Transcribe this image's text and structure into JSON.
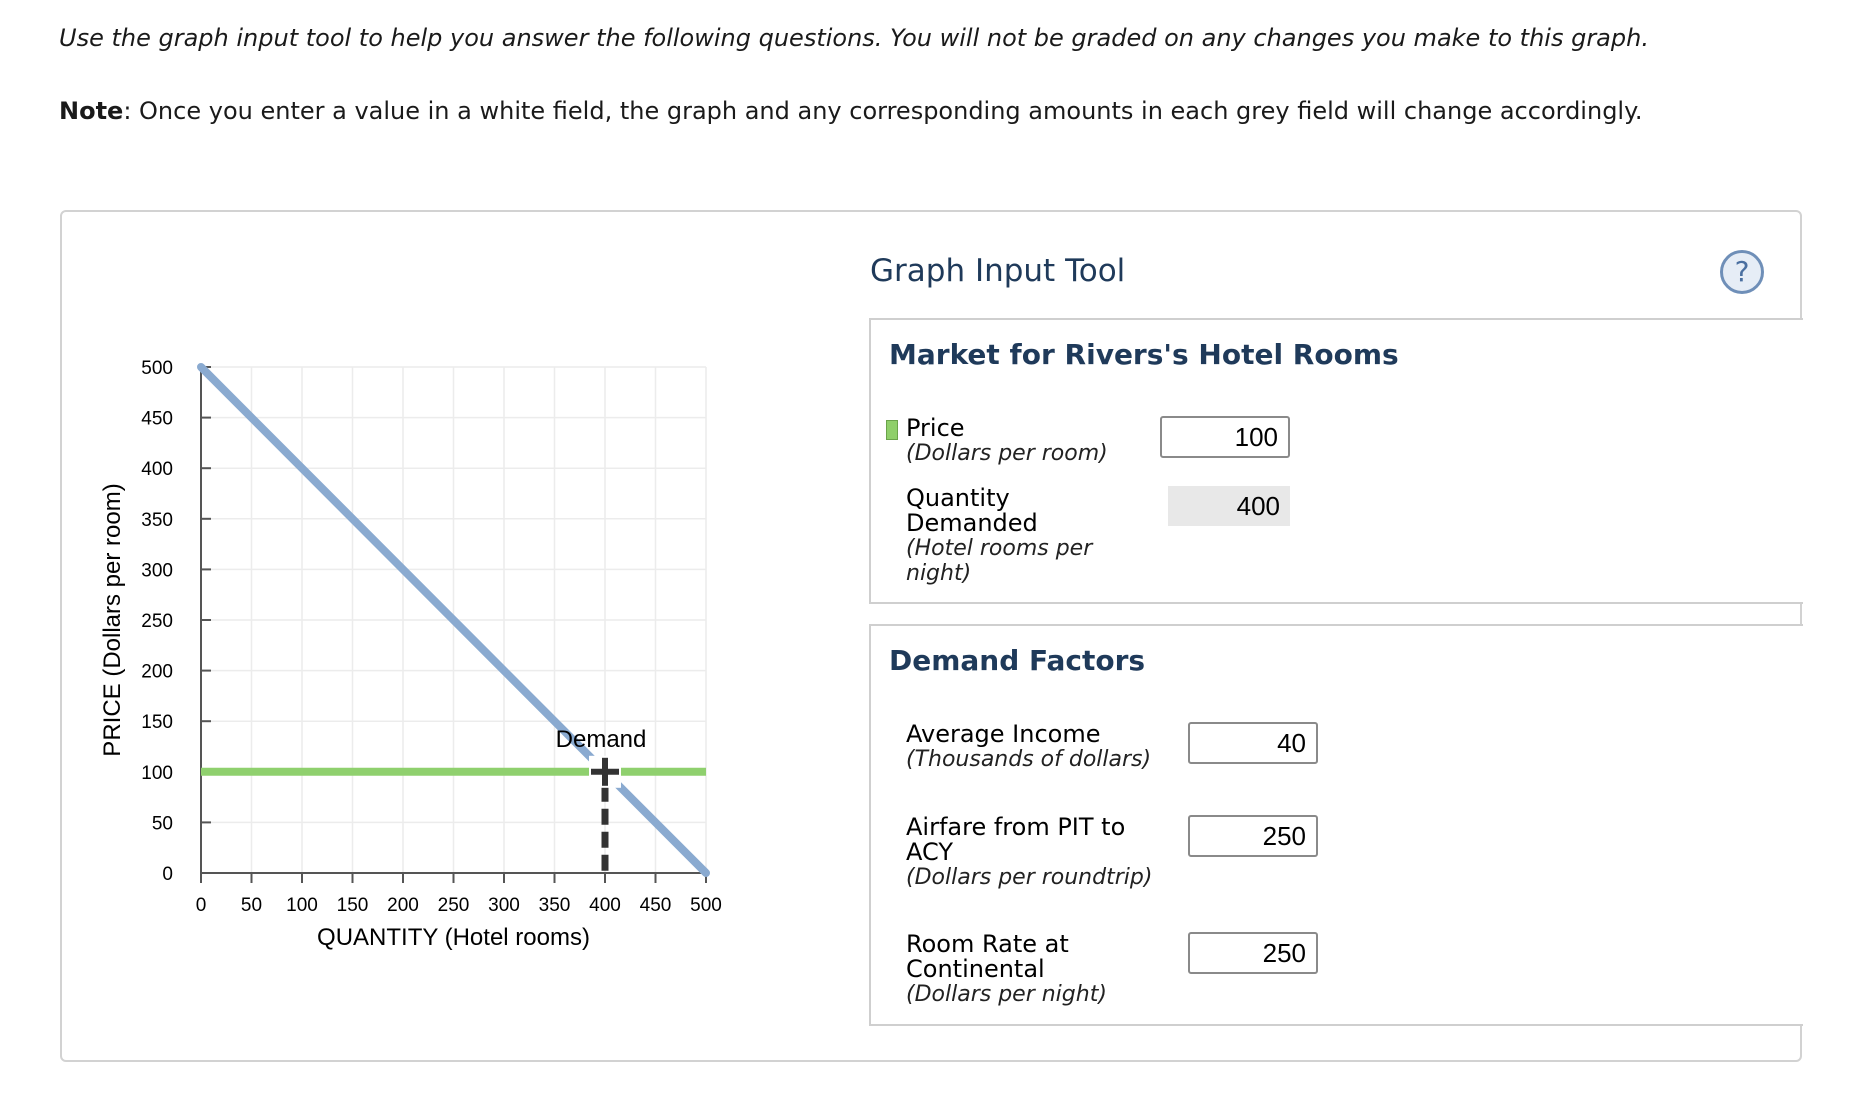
{
  "instructions": "Use the graph input tool to help you answer the following questions. You will not be graded on any changes you make to this graph.",
  "note": {
    "label": "Note",
    "text": ": Once you enter a value in a white field, the graph and any corresponding amounts in each grey field will change accordingly."
  },
  "colors": {
    "demand_line": "#8aaad0",
    "price_line": "#8fd06e",
    "title": "#1f3a5a"
  },
  "chart_data": {
    "type": "line",
    "xlabel": "QUANTITY (Hotel rooms)",
    "ylabel": "PRICE (Dollars per room)",
    "xlim": [
      0,
      500
    ],
    "ylim": [
      0,
      500
    ],
    "x_ticks": [
      0,
      50,
      100,
      150,
      200,
      250,
      300,
      350,
      400,
      450,
      500
    ],
    "y_ticks": [
      0,
      50,
      100,
      150,
      200,
      250,
      300,
      350,
      400,
      450,
      500
    ],
    "grid": true,
    "series": [
      {
        "name": "Demand",
        "x": [
          0,
          500
        ],
        "y": [
          500,
          0
        ]
      }
    ],
    "price_line": {
      "y": 100,
      "x": [
        0,
        500
      ]
    },
    "marker": {
      "x": 400,
      "y": 100
    }
  },
  "tool": {
    "title": "Graph Input Tool",
    "help_icon": "question-circle-icon",
    "help_glyph": "?",
    "market": {
      "title": "Market for Rivers's Hotel Rooms",
      "price_label": "Price",
      "price_unit": "(Dollars per room)",
      "price_value": "100",
      "qd_label": "Quantity Demanded",
      "qd_unit": "(Hotel rooms per night)",
      "qd_value": "400"
    },
    "factors": {
      "title": "Demand Factors",
      "income_label": "Average Income",
      "income_unit": "(Thousands of dollars)",
      "income_value": "40",
      "airfare_label": "Airfare from PIT to ACY",
      "airfare_unit": "(Dollars per roundtrip)",
      "airfare_value": "250",
      "rate_label": "Room Rate at Continental",
      "rate_unit": "(Dollars per night)",
      "rate_value": "250"
    }
  }
}
